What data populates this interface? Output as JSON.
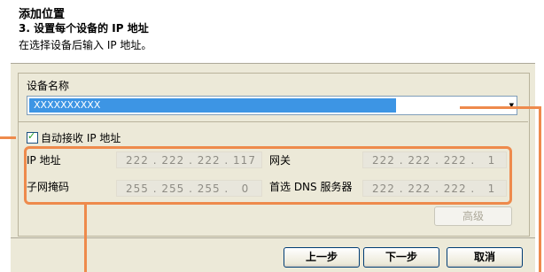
{
  "dialog": {
    "title": "添加位置",
    "step": "3. 设置每个设备的 IP 地址",
    "description": "在选择设备后输入 IP 地址。"
  },
  "device": {
    "label": "设备名称",
    "selected": "XXXXXXXXXX"
  },
  "auto_ip": {
    "label": "自动接收 IP 地址",
    "checked": true
  },
  "ip_settings": {
    "ip_label": "IP 地址",
    "ip_value": "222 . 222 . 222 . 117",
    "gateway_label": "网关",
    "gateway_value": "222 . 222 . 222 .   1",
    "subnet_label": "子网掩码",
    "subnet_value": "255 . 255 . 255 .   0",
    "dns_label": "首选 DNS 服务器",
    "dns_value": "222 . 222 . 222 .   1"
  },
  "buttons": {
    "advanced": "高级",
    "back": "上一步",
    "next": "下一步",
    "cancel": "取消"
  },
  "colors": {
    "callout": "#ee8a4c",
    "selection": "#3d95e4"
  }
}
